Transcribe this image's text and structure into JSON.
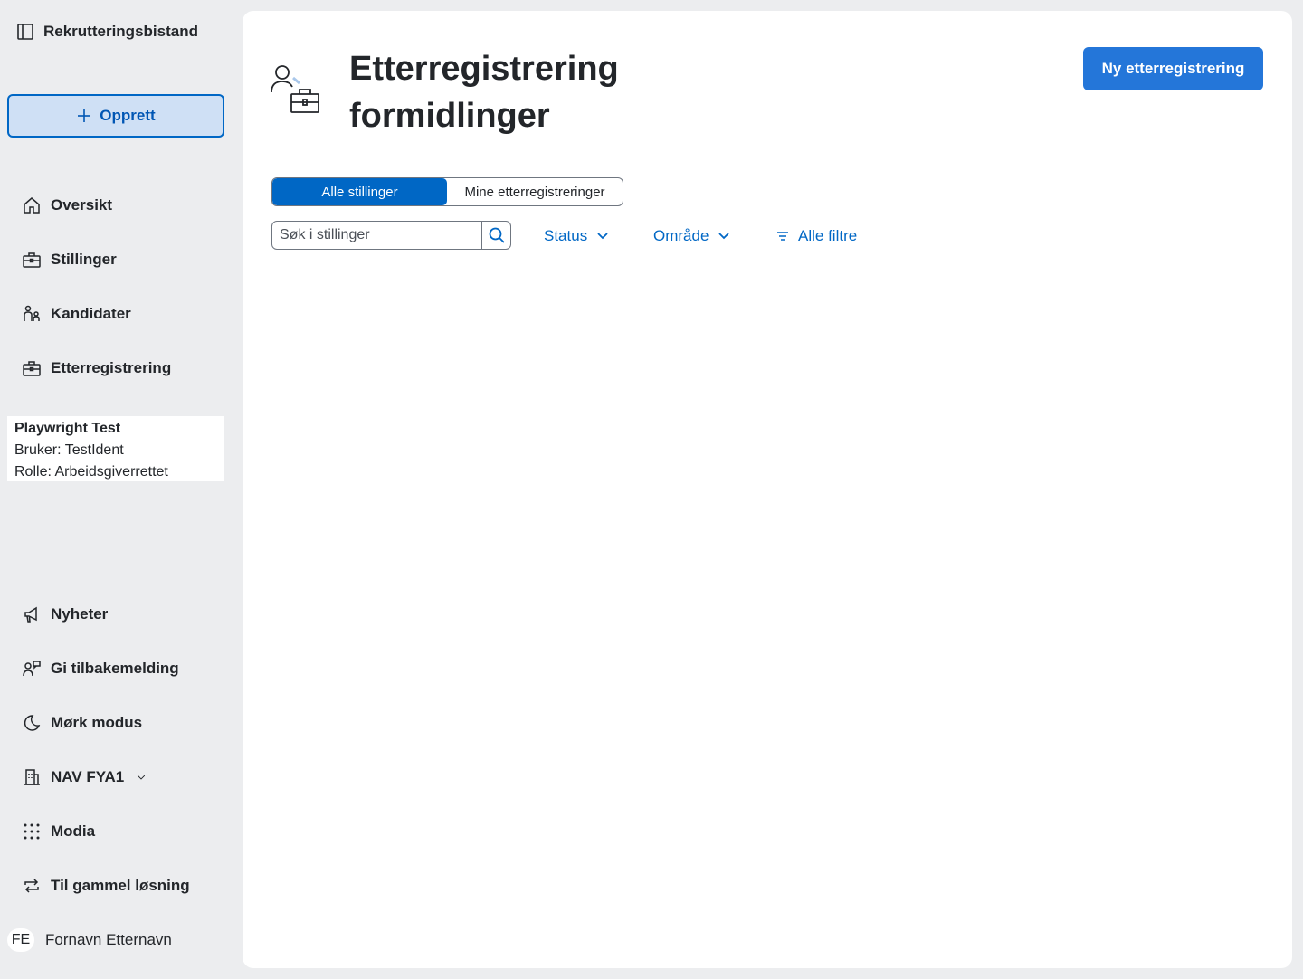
{
  "sidebar": {
    "brand": "Rekrutteringsbistand",
    "create_label": "Opprett",
    "nav": [
      {
        "label": "Oversikt",
        "icon": "house-icon"
      },
      {
        "label": "Stillinger",
        "icon": "briefcase-icon"
      },
      {
        "label": "Kandidater",
        "icon": "people-icon"
      },
      {
        "label": "Etterregistrering",
        "icon": "briefcase-icon"
      }
    ],
    "user": {
      "name": "Playwright Test",
      "ident": "Bruker: TestIdent",
      "role": "Rolle: Arbeidsgiverrettet"
    },
    "bottom": [
      {
        "label": "Nyheter",
        "icon": "megaphone-icon"
      },
      {
        "label": "Gi tilbakemelding",
        "icon": "feedback-icon"
      },
      {
        "label": "Mørk modus",
        "icon": "moon-icon"
      },
      {
        "label": "NAV FYA1",
        "icon": "buildings-icon"
      },
      {
        "label": "Modia",
        "icon": "grid-icon"
      },
      {
        "label": "Til gammel løsning",
        "icon": "arrows-circle-icon"
      }
    ],
    "account": {
      "initials": "FE",
      "name": "Fornavn Etternavn"
    }
  },
  "main": {
    "title": "Etterregistrering formidlinger",
    "new_button": "Ny etterregistrering",
    "tabs": [
      "Alle stillinger",
      "Mine etterregistreringer"
    ],
    "search_placeholder": "Søk i stillinger",
    "filters": {
      "status": "Status",
      "area": "Område",
      "all": "Alle filtre"
    }
  },
  "colors": {
    "accent": "#0067c5",
    "primary_button": "#2476d9",
    "sidebar_bg": "#ecedef"
  }
}
